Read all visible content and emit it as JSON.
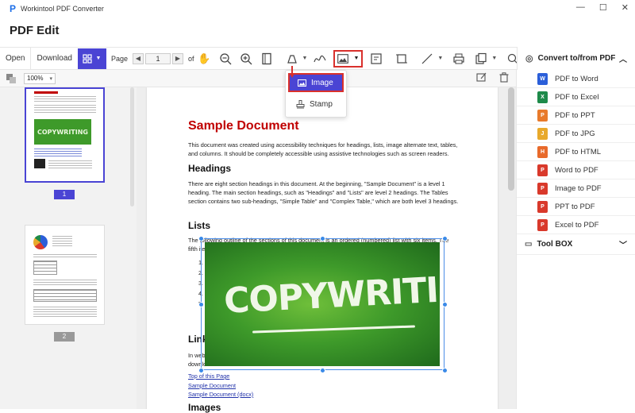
{
  "window": {
    "title": "Workintool PDF Converter",
    "minimize": "—",
    "maximize": "☐",
    "close": "✕"
  },
  "page_heading": "PDF Edit",
  "toolbar": {
    "open": "Open",
    "download": "Download",
    "page_label": "Page",
    "page_value": "1",
    "page_of": "of"
  },
  "convert_section": {
    "title": "Convert to/from PDF",
    "items": [
      {
        "label": "PDF to Word",
        "badge": "W",
        "color": "#2b5fd9"
      },
      {
        "label": "PDF to Excel",
        "badge": "X",
        "color": "#1e8a4a"
      },
      {
        "label": "PDF to PPT",
        "badge": "P",
        "color": "#e87a2b"
      },
      {
        "label": "PDF to JPG",
        "badge": "J",
        "color": "#e8a92b"
      },
      {
        "label": "PDF to HTML",
        "badge": "H",
        "color": "#e86a2b"
      },
      {
        "label": "Word to PDF",
        "badge": "P",
        "color": "#d9392b"
      },
      {
        "label": "Image to PDF",
        "badge": "P",
        "color": "#d9392b"
      },
      {
        "label": "PPT to PDF",
        "badge": "P",
        "color": "#d9392b"
      },
      {
        "label": "Excel to PDF",
        "badge": "P",
        "color": "#d9392b"
      }
    ],
    "toolbox": "Tool BOX"
  },
  "subbar": {
    "zoom": "100%"
  },
  "thumbnails": [
    {
      "page": "1",
      "selected": true
    },
    {
      "page": "2",
      "selected": false
    }
  ],
  "image_menu": {
    "image": "Image",
    "stamp": "Stamp"
  },
  "document": {
    "title": "Sample Document",
    "intro": "This document was created using accessibility techniques for headings, lists, image alternate text, tables, and columns. It should be completely accessible using assistive technologies such as screen readers.",
    "h_headings": "Headings",
    "headings_text": "There are eight section headings in this document. At the beginning, \"Sample Document\" is a level 1 heading. The main section headings, such as \"Headings\" and \"Lists\" are level 2 headings. The Tables section contains two sub-headings, \"Simple Table\" and \"Complex Table,\" which are both level 3 headings.",
    "h_lists": "Lists",
    "lists_text_1": "The following outline of the sections of this document is an ordered (numbered) list with six items. The",
    "lists_text_2": "fifth ite",
    "list_numbers": [
      "1.",
      "2.",
      "3.",
      "4.",
      "5."
    ],
    "h_links": "Link",
    "links_text_1": "In web",
    "links_text_2": "downlo",
    "links": [
      "Top of this Page",
      "Sample Document",
      "Sample Document (docx)"
    ],
    "h_images": "Images",
    "image_text": "COPYWRITING"
  },
  "colors": {
    "accent": "#4a44d4",
    "highlight": "#d9302c",
    "title_red": "#c00000",
    "selection": "#3a8ae8"
  }
}
